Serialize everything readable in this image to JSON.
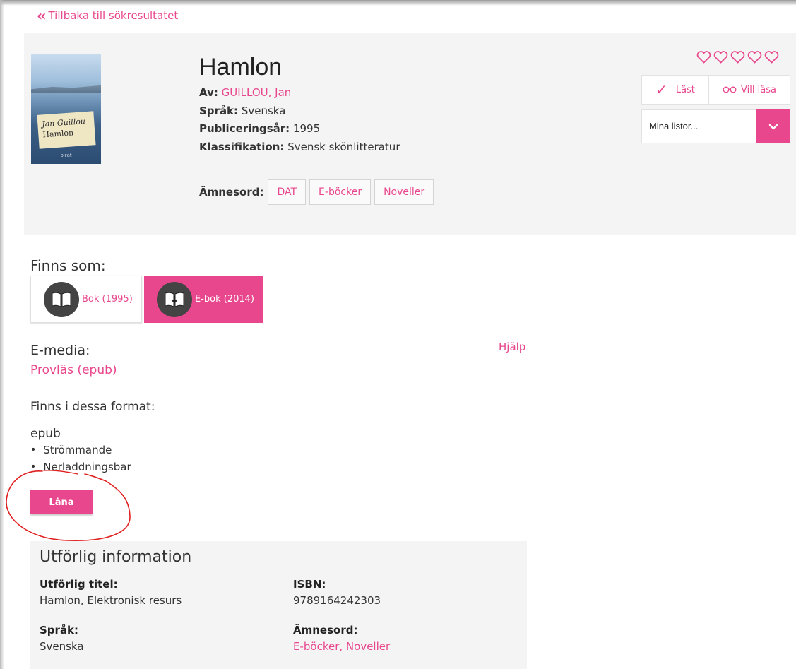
{
  "nav": {
    "back_label": "Tillbaka till sökresultatet"
  },
  "cover": {
    "author": "Jan Guillou",
    "title": "Hamlon",
    "publisher": "pirat"
  },
  "book": {
    "title": "Hamlon",
    "author_label": "Av:",
    "author": "GUILLOU, Jan",
    "language_label": "Språk:",
    "language": "Svenska",
    "year_label": "Publiceringsår:",
    "year": "1995",
    "class_label": "Klassifikation:",
    "classification": "Svensk skönlitteratur",
    "subjects_label": "Ämnesord:",
    "subjects": [
      "DAT",
      "E-böcker",
      "Noveller"
    ]
  },
  "rating": {
    "stars": 5,
    "filled": 0,
    "icon": "heart-outline-icon",
    "color": "#e8478d"
  },
  "actions": {
    "read_label": "Läst",
    "want_label": "Vill läsa",
    "lists_placeholder": "Mina listor..."
  },
  "available": {
    "heading": "Finns som:",
    "formats": [
      {
        "label": "Bok (1995)",
        "icon": "book-open-icon",
        "selected": false
      },
      {
        "label": "E-bok (2014)",
        "icon": "ebook-download-icon",
        "selected": true
      }
    ]
  },
  "emedia": {
    "heading": "E-media:",
    "help": "Hjälp",
    "preview": "Provläs (epub)",
    "formats_heading": "Finns i dessa format:",
    "format_name": "epub",
    "format_options": [
      "Strömmande",
      "Nerladdningsbar"
    ],
    "loan_button": "Låna"
  },
  "details": {
    "heading": "Utförlig information",
    "full_title_label": "Utförlig titel:",
    "full_title": "Hamlon, Elektronisk resurs",
    "isbn_label": "ISBN:",
    "isbn": "9789164242303",
    "language_label": "Språk:",
    "language": "Svenska",
    "subjects_label": "Ämnesord:",
    "subjects": "E-böcker, Noveller"
  },
  "colors": {
    "accent": "#e8478d",
    "panel": "#f4f4f4",
    "annotation": "#e02020"
  }
}
